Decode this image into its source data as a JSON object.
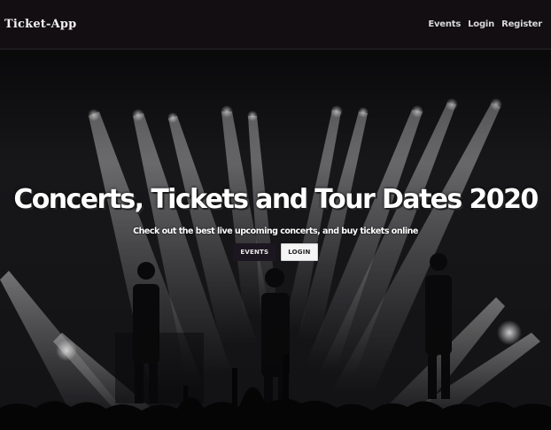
{
  "navbar": {
    "brand": "Ticket-App",
    "links": [
      {
        "label": "Events"
      },
      {
        "label": "Login"
      },
      {
        "label": "Register"
      }
    ]
  },
  "hero": {
    "title": "Concerts, Tickets and Tour Dates 2020",
    "subtitle": "Check out the best live upcoming concerts, and buy tickets online",
    "buttons": {
      "events_label": "EVENTS",
      "login_label": "LOGIN"
    }
  },
  "colors": {
    "navbar_bg": "#120e12",
    "hero_bg": "#1a1a1d",
    "text": "#ffffff",
    "button_dark": "#1b1620",
    "button_light": "#f5f5f5"
  }
}
